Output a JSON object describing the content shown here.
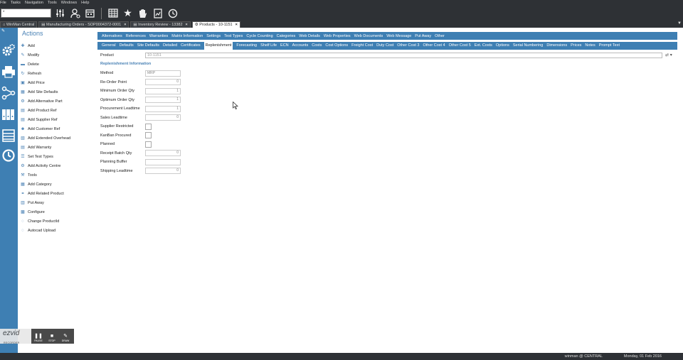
{
  "menu": [
    "File",
    "Tasks",
    "Navigation",
    "Tools",
    "Windows",
    "Help"
  ],
  "search": {
    "value": "*"
  },
  "toolbar_icons": [
    "sliders-icon",
    "user-settings-icon",
    "calendar-icon",
    "grid-icon",
    "star-icon",
    "hand-icon",
    "document-chart-icon",
    "history-icon"
  ],
  "tabs": [
    {
      "label": "WinMan Central",
      "active": false,
      "closable": false
    },
    {
      "label": "Manufacturing Orders - SOP0004372-0001",
      "active": false,
      "closable": true
    },
    {
      "label": "Inventory Review - 13382",
      "active": false,
      "closable": true
    },
    {
      "label": "Products - 10-1151",
      "active": true,
      "closable": true
    }
  ],
  "actions": {
    "title": "Actions",
    "items": [
      {
        "label": "Add",
        "icon": "plus-icon"
      },
      {
        "label": "Modify",
        "icon": "pencil-icon"
      },
      {
        "label": "Delete",
        "icon": "delete-icon"
      },
      {
        "label": "Refresh",
        "icon": "refresh-icon"
      },
      {
        "label": "Add Price",
        "icon": "price-icon"
      },
      {
        "label": "Add Site Defaults",
        "icon": "site-icon"
      },
      {
        "label": "Add Alternative Part",
        "icon": "part-icon"
      },
      {
        "label": "Add Product Ref",
        "icon": "product-ref-icon"
      },
      {
        "label": "Add Supplier Ref",
        "icon": "supplier-icon"
      },
      {
        "label": "Add Customer Ref",
        "icon": "customer-icon"
      },
      {
        "label": "Add Extended Overhead",
        "icon": "overhead-icon"
      },
      {
        "label": "Add Warranty",
        "icon": "warranty-icon"
      },
      {
        "label": "Set Test Types",
        "icon": "test-icon"
      },
      {
        "label": "Add Activity Centre",
        "icon": "activity-icon"
      },
      {
        "label": "Tools",
        "icon": "tools-icon"
      },
      {
        "label": "Add Category",
        "icon": "category-icon"
      },
      {
        "label": "Add Related Product",
        "icon": "related-icon"
      },
      {
        "label": "Put Away",
        "icon": "put-away-icon"
      },
      {
        "label": "Configure",
        "icon": "configure-icon"
      },
      {
        "label": "Change ProductId",
        "icon": "change-icon"
      },
      {
        "label": "Autocad Upload",
        "icon": "upload-icon"
      }
    ]
  },
  "subtabs_row1": [
    "Alternatives",
    "References",
    "Warranties",
    "Matrix Information",
    "Settings",
    "Test Types",
    "Cycle Counting",
    "Categories",
    "Web Details",
    "Web Properties",
    "Web Documents",
    "Web Message",
    "Put Away",
    "Other"
  ],
  "subtabs_row2": [
    "General",
    "Defaults",
    "Site Defaults",
    "Detailed",
    "Certificates",
    "Replenishment",
    "Forecasting",
    "Shelf Life",
    "ECN",
    "Accounts",
    "Costs",
    "Cost Options",
    "Freight Cost",
    "Duty Cost",
    "Other Cost 3",
    "Other Cost 4",
    "Other Cost 5",
    "Ext. Costs",
    "Options",
    "Serial Numbering",
    "Dimensions",
    "Prices",
    "Notes",
    "Prompt Text"
  ],
  "active_subtab": "Replenishment",
  "product": {
    "label": "Product",
    "value": "10-1151"
  },
  "section_title": "Replenishment Information",
  "fields": [
    {
      "label": "Method",
      "value": "MRP",
      "kind": "text"
    },
    {
      "label": "Re-Order Point",
      "value": "0",
      "kind": "number"
    },
    {
      "label": "Minimum Order Qty",
      "value": "1",
      "kind": "number"
    },
    {
      "label": "Optimum Order Qty",
      "value": "1",
      "kind": "number"
    },
    {
      "label": "Procurement Leadtime",
      "value": "1",
      "kind": "number"
    },
    {
      "label": "Sales Leadtime",
      "value": "0",
      "kind": "number"
    },
    {
      "label": "Supplier Restricted",
      "value": "",
      "kind": "checkbox"
    },
    {
      "label": "KanBan Procured",
      "value": "",
      "kind": "checkbox"
    },
    {
      "label": "Planned",
      "value": "",
      "kind": "checkbox"
    },
    {
      "label": "Receipt Batch Qty",
      "value": "0",
      "kind": "number"
    },
    {
      "label": "Planning Buffer",
      "value": "",
      "kind": "text"
    },
    {
      "label": "Shipping Leadtime",
      "value": "0",
      "kind": "number"
    }
  ],
  "recorder": {
    "logo": "ezvid",
    "sub": "RECORDER",
    "buttons": [
      "PAUSE",
      "STOP",
      "DRAW"
    ]
  },
  "status": {
    "user": "winman @ CENTRAL",
    "date": "Monday, 01 Feb 2016"
  }
}
